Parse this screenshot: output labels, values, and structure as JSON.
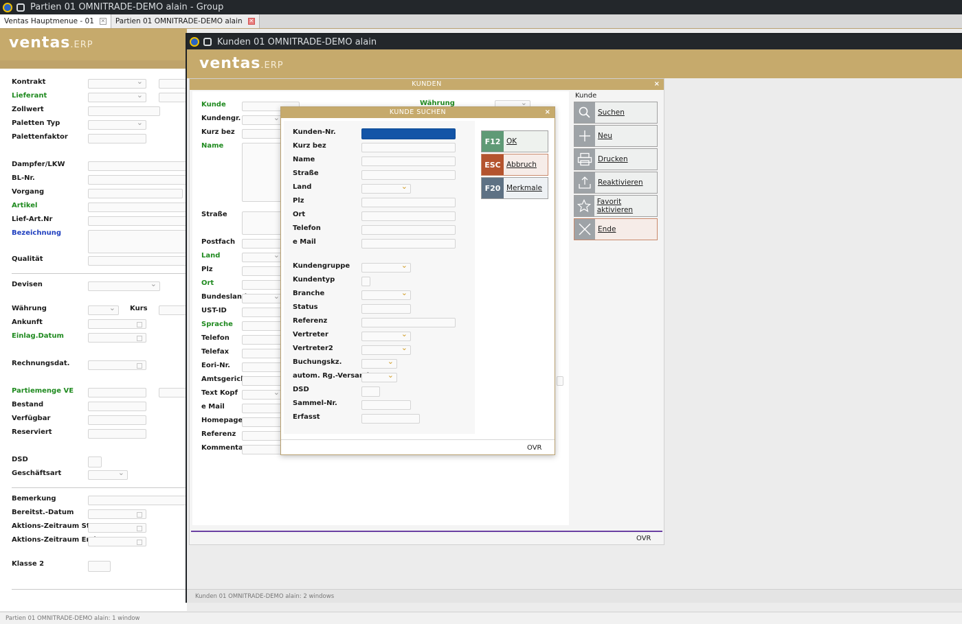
{
  "outer": {
    "title": "Partien 01 OMNITRADE-DEMO alain - Group",
    "tabs": [
      {
        "label": "Ventas Hauptmenue - 01"
      },
      {
        "label": "Partien 01 OMNITRADE-DEMO alain"
      }
    ],
    "logo_main": "ventas",
    "logo_sub": ".ERP",
    "status": "Partien 01 OMNITRADE-DEMO alain: 1 window"
  },
  "partien": {
    "labels": {
      "kontrakt": "Kontrakt",
      "lieferant": "Lieferant",
      "zollwert": "Zollwert",
      "paletten_typ": "Paletten Typ",
      "palettenfaktor": "Palettenfaktor",
      "dampfer": "Dampfer/LKW",
      "bl_nr": "BL-Nr.",
      "vorgang": "Vorgang",
      "artikel": "Artikel",
      "lief_art_nr": "Lief-Art.Nr",
      "bezeichnung": "Bezeichnung",
      "qualitaet": "Qualität",
      "devisen": "Devisen",
      "waehrung": "Währung",
      "kurs": "Kurs",
      "ankunft": "Ankunft",
      "einlag_datum": "Einlag.Datum",
      "rechnungsdat": "Rechnungsdat.",
      "partiemenge": "Partiemenge VE",
      "bestand": "Bestand",
      "verfuegbar": "Verfügbar",
      "reserviert": "Reserviert",
      "dsd": "DSD",
      "geschaeftsart": "Geschäftsart",
      "bemerkung": "Bemerkung",
      "bereitst_datum": "Bereitst.-Datum",
      "aktions_start": "Aktions-Zeitraum Start",
      "aktions_ende": "Aktions-Zeitraum Ende",
      "klasse2": "Klasse 2"
    }
  },
  "kunden": {
    "title": "Kunden 01 OMNITRADE-DEMO alain",
    "panel_title": "KUNDEN",
    "close": "×",
    "status": "Kunden 01 OMNITRADE-DEMO alain: 2 windows",
    "ovr": "OVR",
    "labels": {
      "kunde": "Kunde",
      "kundengr": "Kundengr.",
      "kurz_bez": "Kurz bez",
      "name": "Name",
      "strasse": "Straße",
      "postfach": "Postfach",
      "land": "Land",
      "plz": "Plz",
      "ort": "Ort",
      "bundesland": "Bundesland",
      "ust_id": "UST-ID",
      "sprache": "Sprache",
      "telefon": "Telefon",
      "telefax": "Telefax",
      "eori": "Eori-Nr.",
      "amtsgericht": "Amtsgericht",
      "text_kopf": "Text Kopf",
      "email": "e Mail",
      "homepage": "Homepage",
      "referenz": "Referenz",
      "kommentar": "Kommentar",
      "waehrung": "Währung"
    },
    "side_title": "Kunde",
    "side_buttons": [
      {
        "label": "Suchen",
        "icon": "search-icon"
      },
      {
        "label": "Neu",
        "icon": "plus-icon"
      },
      {
        "label": "Drucken",
        "icon": "printer-icon"
      },
      {
        "label": "Reaktivieren",
        "icon": "upload-icon"
      },
      {
        "label": "Favorit aktivieren",
        "icon": "star-icon"
      },
      {
        "label": "Ende",
        "icon": "close-icon"
      }
    ]
  },
  "suchen": {
    "title": "KUNDE SUCHEN",
    "close": "×",
    "ovr": "OVR",
    "labels": {
      "kunden_nr": "Kunden-Nr.",
      "kurz_bez": "Kurz bez",
      "name": "Name",
      "strasse": "Straße",
      "land": "Land",
      "plz": "Plz",
      "ort": "Ort",
      "telefon": "Telefon",
      "email": "e Mail",
      "kundengruppe": "Kundengruppe",
      "kundentyp": "Kundentyp",
      "branche": "Branche",
      "status": "Status",
      "referenz": "Referenz",
      "vertreter": "Vertreter",
      "vertreter2": "Vertreter2",
      "buchungskz": "Buchungskz.",
      "autom_versand": "autom. Rg.-Versand",
      "dsd": "DSD",
      "sammel_nr": "Sammel-Nr.",
      "erfasst": "Erfasst"
    },
    "buttons": [
      {
        "key": "F12",
        "label": "OK",
        "color": "#5f9a76"
      },
      {
        "key": "ESC",
        "label": "Abbruch",
        "color": "#b4532e"
      },
      {
        "key": "F20",
        "label": "Merkmale",
        "color": "#5e7184"
      }
    ]
  },
  "colors": {
    "brand": "#c6aa6c",
    "green_label": "#1f8a1f",
    "blue_label": "#1f3fbf",
    "selected_field": "#1355a7"
  }
}
